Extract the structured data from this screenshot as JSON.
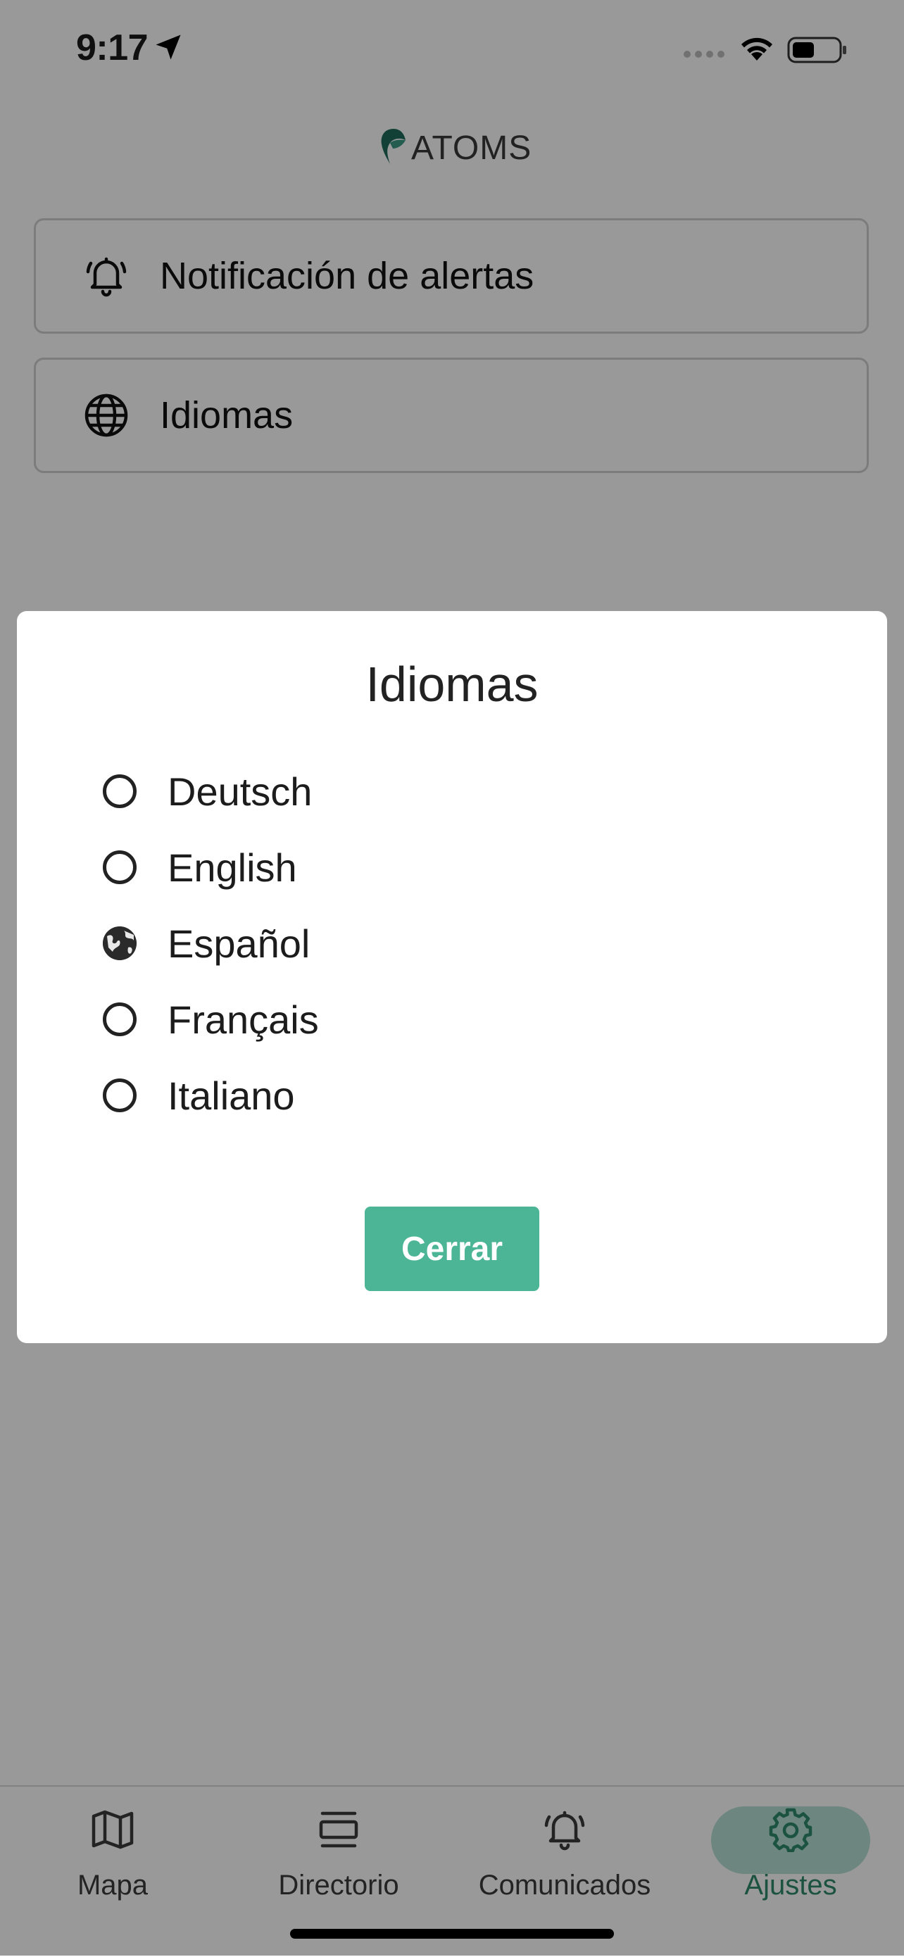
{
  "status_bar": {
    "time": "9:17"
  },
  "header": {
    "logo_text": "ATOMS"
  },
  "settings": {
    "items": [
      {
        "label": "Notificación de alertas",
        "icon": "bell-alert-icon"
      },
      {
        "label": "Idiomas",
        "icon": "globe-icon"
      }
    ]
  },
  "modal": {
    "title": "Idiomas",
    "options": [
      {
        "label": "Deutsch",
        "selected": false
      },
      {
        "label": "English",
        "selected": false
      },
      {
        "label": "Español",
        "selected": true
      },
      {
        "label": "Français",
        "selected": false
      },
      {
        "label": "Italiano",
        "selected": false
      }
    ],
    "close_label": "Cerrar"
  },
  "tabbar": {
    "tabs": [
      {
        "label": "Mapa",
        "icon": "map-icon",
        "active": false
      },
      {
        "label": "Directorio",
        "icon": "directory-icon",
        "active": false
      },
      {
        "label": "Comunicados",
        "icon": "bell-alert-icon",
        "active": false
      },
      {
        "label": "Ajustes",
        "icon": "gear-icon",
        "active": true
      }
    ]
  },
  "colors": {
    "accent": "#4bb596",
    "accent_light": "#b6e0d4",
    "accent_text": "#2f8a6c"
  }
}
